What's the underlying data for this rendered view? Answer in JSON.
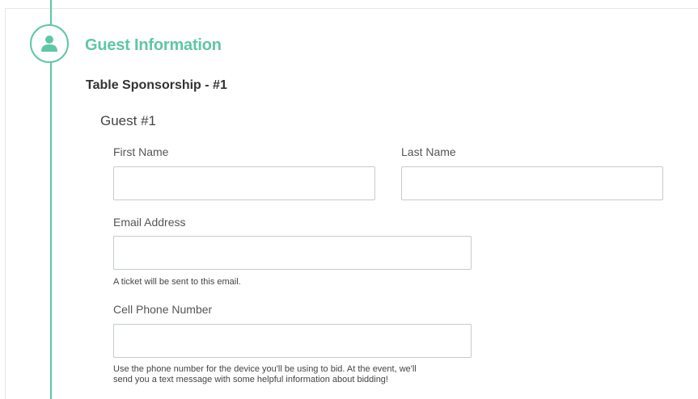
{
  "section": {
    "title": "Guest Information",
    "icon": "user-icon",
    "accent_color": "#5fc6a6"
  },
  "sponsorship": {
    "title": "Table Sponsorship - #1"
  },
  "guest": {
    "title": "Guest #1",
    "first_name": {
      "label": "First Name",
      "value": "",
      "placeholder": ""
    },
    "last_name": {
      "label": "Last Name",
      "value": "",
      "placeholder": ""
    },
    "email": {
      "label": "Email Address",
      "value": "",
      "placeholder": "",
      "help": "A ticket will be sent to this email."
    },
    "phone": {
      "label": "Cell Phone Number",
      "value": "",
      "placeholder": "",
      "help_line1": "Use the phone number for the device you'll be using to bid. At the event, we'll",
      "help_line2": "send you a text message with some helpful information about bidding!"
    }
  }
}
